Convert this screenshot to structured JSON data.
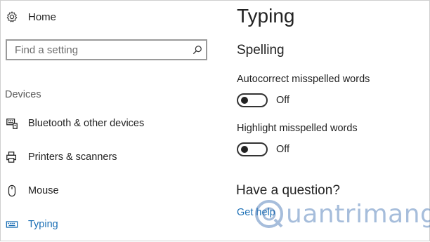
{
  "sidebar": {
    "home_label": "Home",
    "search_placeholder": "Find a setting",
    "section_header": "Devices",
    "items": [
      {
        "label": "Bluetooth & other devices",
        "icon": "bluetooth-keyboard-icon"
      },
      {
        "label": "Printers & scanners",
        "icon": "printer-icon"
      },
      {
        "label": "Mouse",
        "icon": "mouse-icon"
      },
      {
        "label": "Typing",
        "icon": "keyboard-icon",
        "active": true
      }
    ]
  },
  "main": {
    "title": "Typing",
    "group_title": "Spelling",
    "settings": [
      {
        "label": "Autocorrect misspelled words",
        "state": "Off"
      },
      {
        "label": "Highlight misspelled words",
        "state": "Off"
      }
    ],
    "question": "Have a question?",
    "help_link": "Get help"
  },
  "watermark": {
    "text": "uantrimang",
    "logo": "quantrimang-logo"
  },
  "colors": {
    "accent": "#1b6fb5",
    "toggle_off": "#333333"
  }
}
